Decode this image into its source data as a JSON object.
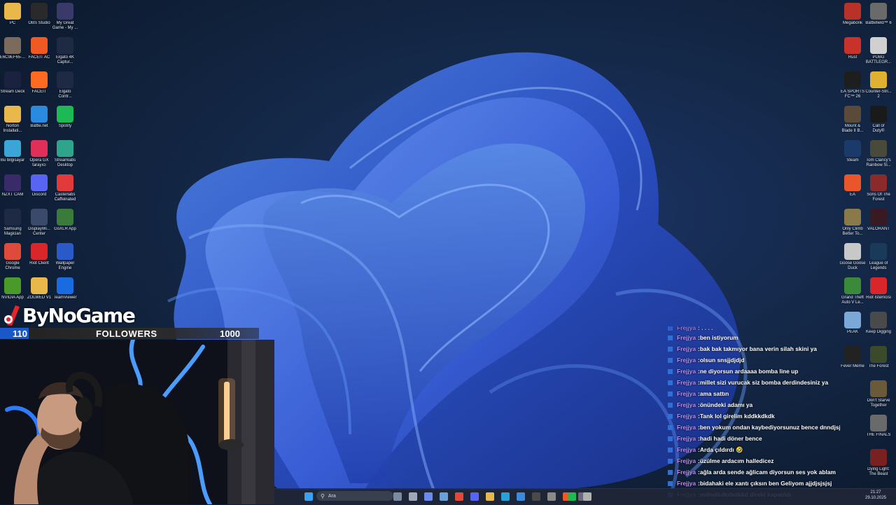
{
  "desktop": {
    "left_columns": [
      [
        {
          "label": "PC",
          "icon": "folder-icon",
          "color": "#e8b84a"
        },
        {
          "label": "E6C9EF65-...",
          "icon": "image-file-icon",
          "color": "#7a6b5a"
        },
        {
          "label": "Stream Deck",
          "icon": "stream-deck-icon",
          "color": "#1a2240"
        },
        {
          "label": "Norton\nInstallati...",
          "icon": "folder-icon",
          "color": "#e8b84a"
        },
        {
          "label": "Bu bilgisayar",
          "icon": "monitor-icon",
          "color": "#3aa6d8"
        },
        {
          "label": "NZXT CAM",
          "icon": "nzxt-icon",
          "color": "#3a2a6a"
        },
        {
          "label": "Samsung\nMagician",
          "icon": "samsung-icon",
          "color": "#1e2a44"
        },
        {
          "label": "Google\nChrome",
          "icon": "chrome-icon",
          "color": "#e04a3a"
        },
        {
          "label": "NVIDIA App",
          "icon": "nvidia-icon",
          "color": "#4a9a2a"
        }
      ],
      [
        {
          "label": "OBS Studio",
          "icon": "obs-icon",
          "color": "#2a2a2a"
        },
        {
          "label": "FACEIT AC",
          "icon": "faceit-icon",
          "color": "#f05a22"
        },
        {
          "label": "FACEIT",
          "icon": "faceit-icon",
          "color": "#ff6a22"
        },
        {
          "label": "Battle.net",
          "icon": "battlenet-icon",
          "color": "#2a8ae0"
        },
        {
          "label": "Opera GX\ntarayıcı",
          "icon": "opera-gx-icon",
          "color": "#e0305a"
        },
        {
          "label": "Discord",
          "icon": "discord-icon",
          "color": "#5865f2"
        },
        {
          "label": "DisplayWi...\nCenter",
          "icon": "display-icon",
          "color": "#3a4a6a"
        },
        {
          "label": "Riot Client",
          "icon": "riot-icon",
          "color": "#d8262a"
        },
        {
          "label": "ZOLWED V1",
          "icon": "folder-icon",
          "color": "#e8b84a"
        }
      ],
      [
        {
          "label": "My Great\nGame - My ...",
          "icon": "game-icon",
          "color": "#3a3a6a"
        },
        {
          "label": "Elgato 4K\nCaptur...",
          "icon": "elgato-4k-icon",
          "color": "#1e2a44"
        },
        {
          "label": "Elgato\nContr...",
          "icon": "elgato-icon",
          "color": "#1e2a44"
        },
        {
          "label": "Spotify",
          "icon": "spotify-icon",
          "color": "#1db954"
        },
        {
          "label": "Streamlabs\nDesktop",
          "icon": "streamlabs-icon",
          "color": "#2ea58a"
        },
        {
          "label": "Casterlabs\nCaffeinated",
          "icon": "casterlabs-icon",
          "color": "#e03a3a"
        },
        {
          "label": "GoXLR App",
          "icon": "goxlr-icon",
          "color": "#3a7a3a"
        },
        {
          "label": "Wallpaper\nEngine",
          "icon": "wallpaper-engine-icon",
          "color": "#2a5ac8"
        },
        {
          "label": "TeamViewer",
          "icon": "teamviewer-icon",
          "color": "#1a6ae0"
        }
      ]
    ],
    "right_columns": [
      [
        {
          "label": "Megabonk",
          "icon": "megabonk-icon",
          "color": "#b8322a"
        },
        {
          "label": "Rust",
          "icon": "rust-icon",
          "color": "#c8322a"
        },
        {
          "label": "EA SPORTS\nFC™ 26",
          "icon": "ea-fc-icon",
          "color": "#1e1e1e"
        },
        {
          "label": "Mount &\nBlade II B...",
          "icon": "mount-blade-icon",
          "color": "#5a4a3a"
        },
        {
          "label": "Steam",
          "icon": "steam-icon",
          "color": "#1a3a6a"
        },
        {
          "label": "EA",
          "icon": "ea-icon",
          "color": "#e8562a"
        },
        {
          "label": "Only Climb\nBetter To...",
          "icon": "only-climb-icon",
          "color": "#8a7a4a"
        },
        {
          "label": "Goose Goose\nDuck",
          "icon": "goose-icon",
          "color": "#c8c8c8"
        },
        {
          "label": "Grand Theft\nAuto V Le...",
          "icon": "gta-icon",
          "color": "#3a8a3a"
        },
        {
          "label": "PEAK",
          "icon": "peak-icon",
          "color": "#7aa8d8"
        },
        {
          "label": "Fever Meme",
          "icon": "fever-meme-icon",
          "color": "#222222"
        }
      ],
      [
        {
          "label": "Battlefield™ 6",
          "icon": "battlefield-icon",
          "color": "#6a6a6a"
        },
        {
          "label": "PUBG\nBATTLEGR...",
          "icon": "pubg-icon",
          "color": "#d0d0d0"
        },
        {
          "label": "Counter-Stri...\n2",
          "icon": "cs2-icon",
          "color": "#e0b030"
        },
        {
          "label": "Call of\nDuty®",
          "icon": "cod-icon",
          "color": "#1a1a1a"
        },
        {
          "label": "Tom Clancy's\nRainbow Si...",
          "icon": "rainbow-six-icon",
          "color": "#4a4a3a"
        },
        {
          "label": "Sons Of The\nForest",
          "icon": "sons-forest-icon",
          "color": "#8a2a2a"
        },
        {
          "label": "VALORANT",
          "icon": "valorant-icon",
          "color": "#3a1a22"
        },
        {
          "label": "League of\nLegends",
          "icon": "lol-icon",
          "color": "#1a3a5a"
        },
        {
          "label": "Riot İstemcisi",
          "icon": "riot-icon",
          "color": "#d8262a"
        },
        {
          "label": "Keep Digging",
          "icon": "keep-digging-icon",
          "color": "#4a4a4a"
        },
        {
          "label": "The Forest",
          "icon": "the-forest-icon",
          "color": "#3a4a2a"
        },
        {
          "label": "Don't Starve\nTogether",
          "icon": "dont-starve-icon",
          "color": "#6a5a3a"
        },
        {
          "label": "THE FINALS",
          "icon": "the-finals-icon",
          "color": "#6a6a6a"
        },
        {
          "label": "Dying Light:\nThe Beast",
          "icon": "dying-light-icon",
          "color": "#7a2020"
        }
      ]
    ]
  },
  "overlay": {
    "brand": "ByNoGame",
    "followers_current": "110",
    "followers_label": "FOLLOWERS",
    "followers_goal": "1000",
    "followers_progress": 0.11
  },
  "chat": [
    {
      "user": "Frejjya",
      "msg": "ben istiyorum"
    },
    {
      "user": "Frejjya",
      "msg": "bak bak takmıyor bana verin silah skini ya"
    },
    {
      "user": "Frejjya",
      "msg": "olsun snsjjdjdjd"
    },
    {
      "user": "Frejjya",
      "msg": "ne diyorsun ardaaaa bomba line up"
    },
    {
      "user": "Frejjya",
      "msg": "millet sizi vurucak siz bomba derdindesiniz ya"
    },
    {
      "user": "Frejjya",
      "msg": "ama sattın"
    },
    {
      "user": "Frejjya",
      "msg": "önündeki adamı ya"
    },
    {
      "user": "Frejjya",
      "msg": "Tank lol girelim kddkkdkdk"
    },
    {
      "user": "Frejjya",
      "msg": "ben yokum ondan kaybediyorsunuz bence dnndjsjsjjd"
    },
    {
      "user": "Frejjya",
      "msg": "hadi hadi döner bence"
    },
    {
      "user": "Frejjya",
      "msg": "Arda çıldırdı 🤣"
    },
    {
      "user": "Frejjya",
      "msg": "üzülme ardacım halledicez"
    },
    {
      "user": "Frejjya",
      "msg": "ağla arda sende ağlicam diyorsun ses yok ablam"
    },
    {
      "user": "Frejjya",
      "msg": "bidahaki ele xantı çıksın ben Geliyom ajjdjsjsjsj"
    },
    {
      "user": "Frejjya",
      "msg": "mdmdkdkdkdkkd direkt kapatıldı"
    }
  ],
  "taskbar": {
    "search_placeholder": "Ara",
    "clock_time": "21:27",
    "clock_date": "29.10.2025",
    "pinned": [
      {
        "name": "start-icon",
        "color": "#3aa0f0"
      },
      {
        "name": "widgets-icon",
        "color": "#7a8aa0"
      },
      {
        "name": "task-view-icon",
        "color": "#a0a8b8"
      },
      {
        "name": "copilot-icon",
        "color": "#6a8af0"
      },
      {
        "name": "steam-icon",
        "color": "#6aa0d8"
      },
      {
        "name": "chrome-icon",
        "color": "#e04a3a"
      },
      {
        "name": "discord-icon",
        "color": "#5865f2"
      },
      {
        "name": "file-explorer-icon",
        "color": "#e8b84a"
      },
      {
        "name": "edge-icon",
        "color": "#2aa0d8"
      },
      {
        "name": "store-icon",
        "color": "#3a8ae0"
      },
      {
        "name": "obs-icon",
        "color": "#4a4a4a"
      },
      {
        "name": "elgato-icon",
        "color": "#8a8a8a"
      },
      {
        "name": "faceit-icon",
        "color": "#f05a22"
      },
      {
        "name": "calculator-icon",
        "color": "#6a6a7a"
      },
      {
        "name": "spotify-icon",
        "color": "#1db954"
      },
      {
        "name": "goose-icon",
        "color": "#b0b0b0"
      }
    ]
  }
}
